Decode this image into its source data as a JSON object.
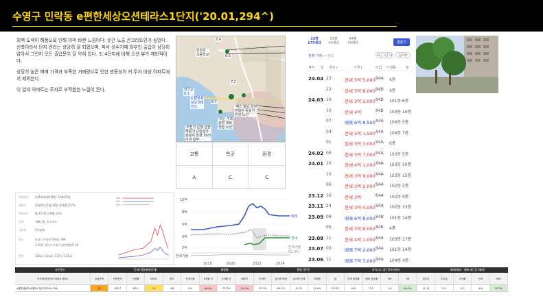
{
  "header": {
    "title": "수영구 민락동 e편한세상오션테라스1단지('20.01,294^)"
  },
  "description": {
    "paragraphs": [
      "외벽 도색이 해풍으로 인해 이미 바랜 느낌이다. 순간 노출 콘크리트인가 싶었다. 신축이라서 단지 관리는 상당히 잘 되었으며, 피서 성수기때 외부인 출입이 상당히 많아서 그런지 모든 출입문이 잘 막혀 있다. 3, 4단지에 비해 오션 뷰가 제한적이다.",
      "상당히 높은 매매 가격과 부족한 거래량으로 인한 변동성이 커 투자 대상 아파트에서 제외한다.",
      "이 일대 아파트는 투자로 부적합한 느낌이 든다."
    ]
  },
  "map": {
    "labels": [
      "7.4",
      "민락초\n초등학교",
      "6.5",
      "한국교\n0.1",
      "e 편한세\n상오션테\n라스",
      "6.7",
      "7.2",
      "'엑스 철도 상권\n번화한 중심가\n반경 노선'",
      "'쉬는 구조\n광장 대로\n한정 노선'",
      "'자전거 운행 상권\n해운대 근린상가\n관광지 반경 3km\n이내 일부'"
    ]
  },
  "ratings": {
    "headers": [
      "교통",
      "학군",
      "환경"
    ],
    "values": [
      "A",
      "C",
      "C"
    ]
  },
  "transactions": {
    "tabs": [
      {
        "line1": "33평",
        "line2": "175세대",
        "active": true
      },
      {
        "line1": "35평",
        "line2": "40세대",
        "active": false
      },
      {
        "line1": "44평",
        "line2": "79세대",
        "active": false
      }
    ],
    "tab_button": "평층기",
    "filter_label": "전체 거래",
    "filter_label2": "↔ 정보",
    "filter_btn1": "최근 1년 내",
    "filter_btn2": "실거래",
    "columns": [
      "계약",
      "일",
      "경과↓",
      "가격↓",
      "타입",
      "거래동",
      "층"
    ],
    "rows": [
      {
        "month": "24.04",
        "day": "23",
        "price": "전세 3억 5,000",
        "kind": "jeonse",
        "type": "84A",
        "floor": "4층"
      },
      {
        "month": "",
        "day": "22",
        "price": "전세 3억 8,000",
        "kind": "jeonse",
        "type": "84B",
        "floor": "4층"
      },
      {
        "month": "24.03",
        "day": "19",
        "price": "전세 3억 2,000",
        "kind": "jeonse",
        "type": "84B",
        "floor": "101동  6층"
      },
      {
        "month": "",
        "day": "16",
        "price": "전세 4억",
        "kind": "jeonse",
        "type": "84B",
        "floor": "103동 10층"
      },
      {
        "month": "",
        "day": "07",
        "price": "매매 6억 8,500",
        "kind": "sale",
        "type": "84A",
        "floor": "104동  5층"
      },
      {
        "month": "",
        "day": "04",
        "price": "전세 3억 1,500",
        "kind": "jeonse",
        "type": "84A",
        "floor": "104동  7층"
      },
      {
        "month": "",
        "day": "01",
        "price": "전세 3억 3,000",
        "kind": "jeonse",
        "type": "84A",
        "floor": "6층"
      },
      {
        "month": "24.02",
        "day": "06",
        "price": "전세 3억 7,000",
        "kind": "jeonse",
        "type": "84A",
        "floor": "103동  5층"
      },
      {
        "month": "24.01",
        "day": "20",
        "price": "전세 4억 1,000",
        "kind": "jeonse",
        "type": "84A",
        "floor": "103동 20층"
      },
      {
        "month": "",
        "day": "10",
        "price": "전세 3억 9,000",
        "kind": "jeonse",
        "type": "84A",
        "floor": "103동 15층"
      },
      {
        "month": "",
        "day": "06",
        "price": "전세 3억 2,000",
        "kind": "jeonse",
        "type": "84A",
        "floor": "102동  2층"
      },
      {
        "month": "23.12",
        "day": "16",
        "price": "전세 3억",
        "kind": "jeonse",
        "type": "84A",
        "floor": "102동  9층"
      },
      {
        "month": "23.11",
        "day": "24",
        "price": "전세 3억 4,000",
        "kind": "jeonse",
        "type": "84A",
        "floor": "102동 13층"
      },
      {
        "month": "23.09",
        "day": "09",
        "price": "매매 6억 8,000",
        "kind": "sale",
        "type": "84B",
        "floor": "101동 14층"
      },
      {
        "month": "",
        "day": "05",
        "price": "전세 3억 8,000",
        "kind": "jeonse",
        "type": "84B",
        "floor": "4층"
      },
      {
        "month": "23.08",
        "day": "11",
        "price": "전세 4억 1,000",
        "kind": "jeonse",
        "type": "84A",
        "floor": "103동 17층"
      },
      {
        "month": "23.07",
        "day": "03",
        "price": "매매 7억 2,000",
        "kind": "sale",
        "type": "84A",
        "floor": "101동 14층"
      },
      {
        "month": "23.06",
        "day": "11",
        "price": "매매 7억 3,000",
        "kind": "sale",
        "type": "84A",
        "floor": "104동  4층"
      }
    ]
  },
  "info": {
    "rows": [
      {
        "k": "사용승인",
        "v": "294세대(총4개동)    15층/25층"
      },
      {
        "k": "세대수",
        "v": "2020년 01월 16일    용적률 257%"
      },
      {
        "k": "주차대수",
        "v": "총 457대    건폐율 24%"
      },
      {
        "k": "난방",
        "v": "개별난방, 도시가스"
      },
      {
        "k": "시공사",
        "v": "(주)삼호"
      },
      {
        "k": "주소",
        "v": "부산시 수영구 민락동 799"
      },
      {
        "k": "",
        "v": "도로명: 부산시 수영구 광안해변로 10"
      },
      {
        "k": "면적",
        "v": "108㎡, 114㎡, 117㎡, 145㎡"
      }
    ]
  },
  "linechart": {
    "ylabels": [
      "10억",
      "8억",
      "6억",
      "4억",
      "2억"
    ],
    "xlabels": [
      "2018",
      "2020",
      "2022",
      "2024"
    ],
    "legend_sale": "매매",
    "legend_jeonse": "전세",
    "bottom_label": "전세가율",
    "rate_label": "전세가율",
    "rate_value": "52.3%",
    "colors": {
      "sale": "#3a55d4",
      "jeonse": "#2e9e3a",
      "rate": "#888888"
    }
  },
  "btable": {
    "groups": [
      "기본정보",
      "전세가율(매매/전세)",
      "평형별",
      "평형 (면적)",
      "마이너스 갭 (전세-매매)",
      "매매(매매 - 매매 매) 갭 (매매)"
    ],
    "headers": [
      "단지명(준공연도·세대수·평당)",
      "공급면적",
      "전용면적",
      "전용률",
      "세대수",
      "층수",
      "전세가율",
      "6개월 전",
      "3개월 전",
      "매매가",
      "전세가",
      "실거래 매매",
      "실거래 전세",
      "거래량",
      "갭",
      "전세 상승률",
      "매매 상승률",
      "PIR",
      "JIR",
      "갭투자",
      "투자금",
      "수익률",
      "전세",
      "매매"
    ],
    "values": [
      "e편한세상오션테라스1단지(2020·294)",
      "33",
      "108.7",
      "83.0",
      "7.0",
      "0.6",
      "3.6",
      "48.6%",
      "12.2%",
      "-24.3%",
      "35.7%",
      "89.1%",
      "6.1%",
      "11.6%",
      "23.03",
      "6.6",
      "3.2",
      "3.4",
      "48.5%",
      "12.11",
      "9.5",
      "3.2",
      "-6.4",
      "43.3%"
    ]
  }
}
